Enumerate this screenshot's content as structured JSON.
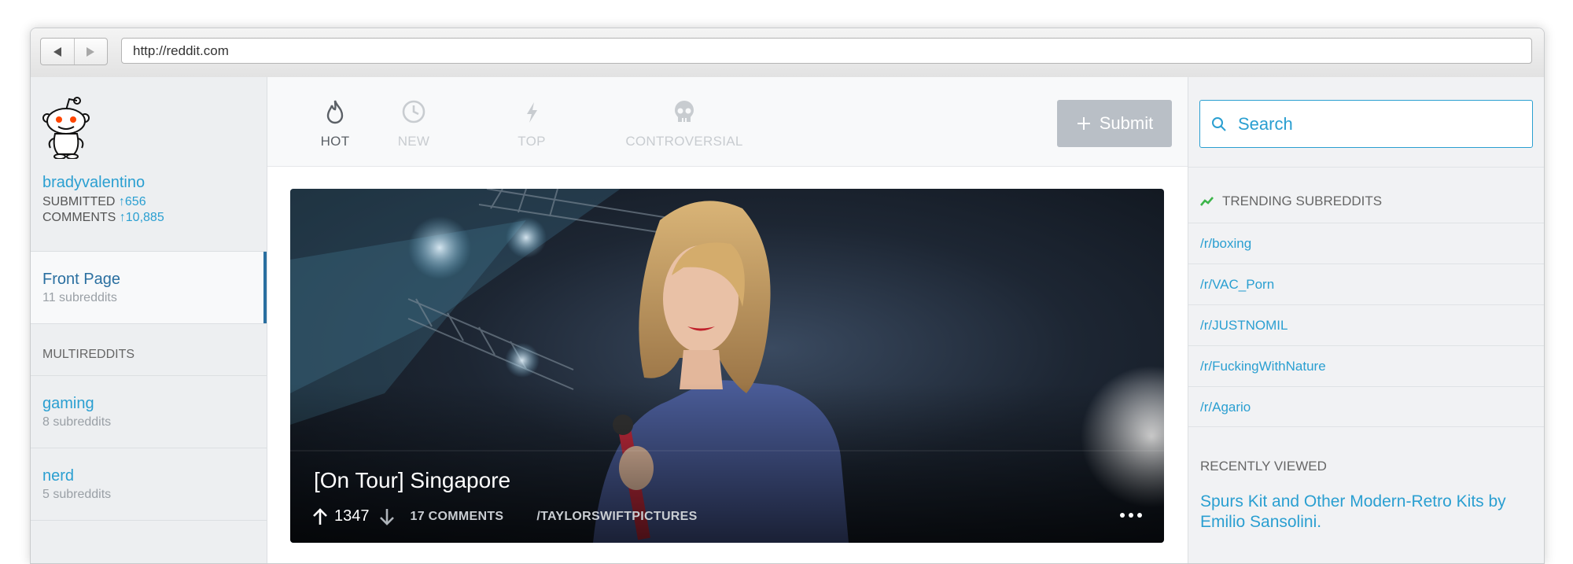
{
  "browser": {
    "url": "http://reddit.com",
    "back_icon": "back-arrow-icon",
    "forward_icon": "forward-arrow-icon"
  },
  "profile": {
    "avatar_icon": "reddit-alien-icon",
    "username": "bradyvalentino",
    "submitted_label": "SUBMITTED",
    "submitted_value": "656",
    "comments_label": "COMMENTS",
    "comments_value": "10,885"
  },
  "left_nav": {
    "front_page": {
      "label": "Front Page",
      "sub": "11 subreddits"
    },
    "multireddits_heading": "MULTIREDDITS",
    "items": [
      {
        "label": "gaming",
        "sub": "8 subreddits"
      },
      {
        "label": "nerd",
        "sub": "5 subreddits"
      }
    ]
  },
  "toolbar": {
    "tabs": [
      {
        "label": "HOT",
        "icon": "flame-icon",
        "active": true
      },
      {
        "label": "NEW",
        "icon": "clock-icon",
        "active": false
      },
      {
        "label": "TOP",
        "icon": "lightning-icon",
        "active": false
      },
      {
        "label": "CONTROVERSIAL",
        "icon": "skull-icon",
        "active": false
      }
    ],
    "submit_label": "Submit"
  },
  "post": {
    "title": "[On Tour] Singapore",
    "score": "1347",
    "comments": "17 COMMENTS",
    "subreddit": "/TAYLORSWIFTPICTURES"
  },
  "right": {
    "search_placeholder": "Search",
    "trending_heading": "TRENDING SUBREDDITS",
    "subreddits": [
      "/r/boxing",
      "/r/VAC_Porn",
      "/r/JUSTNOMIL",
      "/r/FuckingWithNature",
      "/r/Agario"
    ],
    "recent_heading": "RECENTLY VIEWED",
    "recent_item": "Spurs Kit and Other Modern-Retro Kits by Emilio Sansolini."
  },
  "colors": {
    "accent": "#2a9fd1",
    "active_nav": "#2a6fa0",
    "submit_bg": "#b9bfc6",
    "trend_green": "#3cb54a"
  }
}
